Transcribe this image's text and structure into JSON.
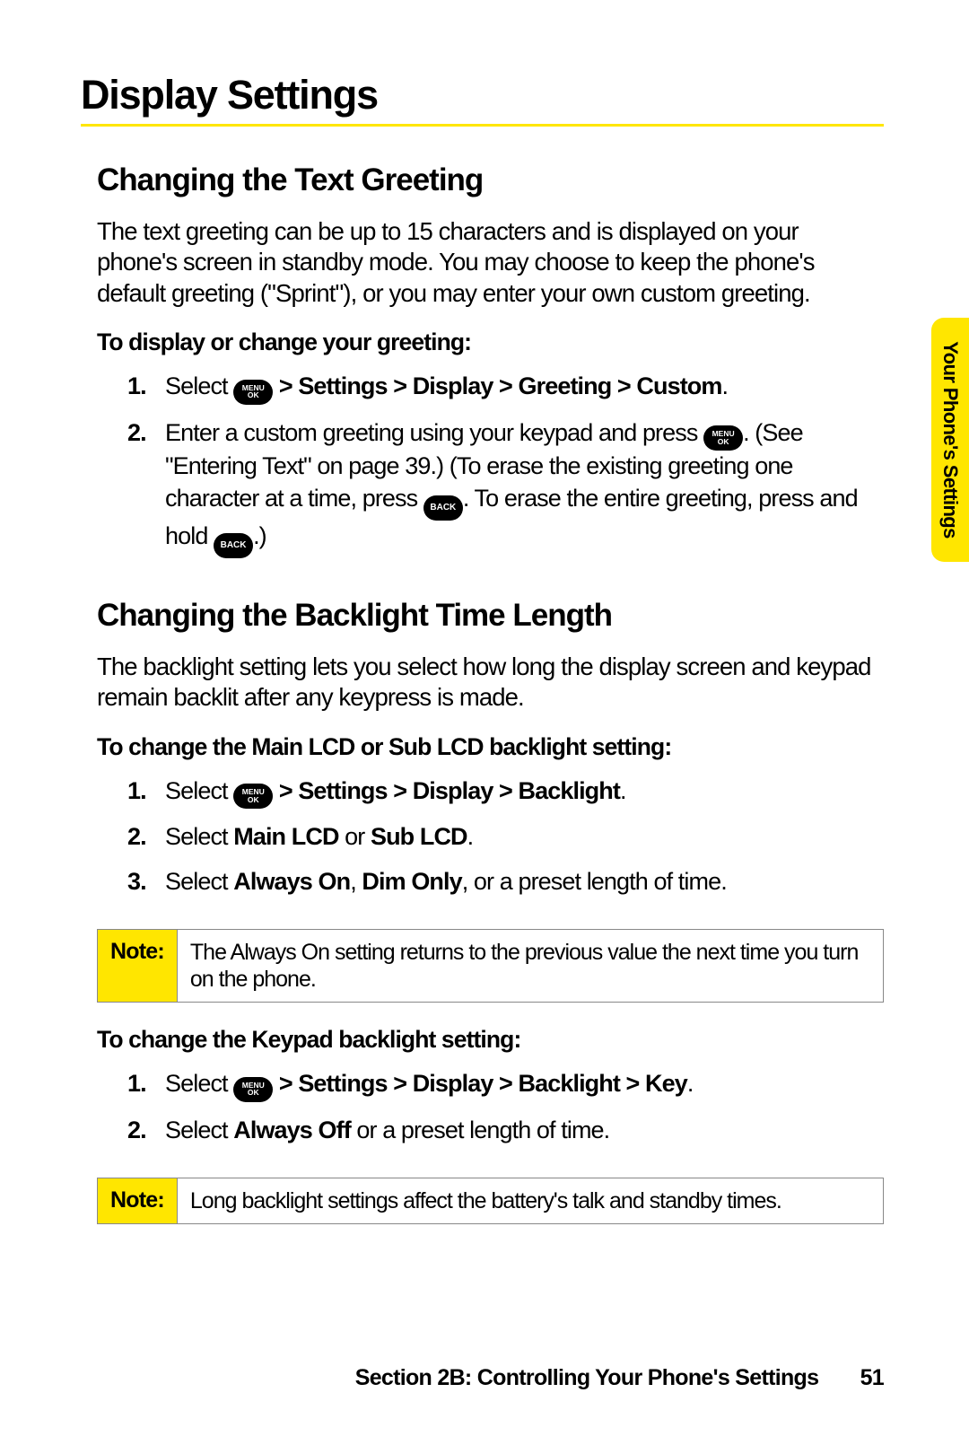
{
  "title": "Display Settings",
  "side_tab": "Your Phone's Settings",
  "section_greeting": {
    "heading": "Changing the Text Greeting",
    "intro": "The text greeting can be up to 15 characters and is displayed on your phone's screen in standby mode. You may choose to keep the phone's default greeting (\"Sprint\"), or you may enter your own custom greeting.",
    "lead": "To display or change your greeting:",
    "step1_a": "Select ",
    "step1_b": " > Settings > Display > Greeting > Custom",
    "step2_a": "Enter a custom greeting using your keypad and press ",
    "step2_b": ". (See \"Entering Text\" on page 39.) (To erase the existing greeting one character at a time, press ",
    "step2_c": ". To erase the entire greeting, press and hold ",
    "step2_d": ".)"
  },
  "section_backlight": {
    "heading": "Changing the Backlight Time Length",
    "intro": "The backlight setting lets you select how long the display screen and keypad remain backlit after any keypress is made.",
    "lead_lcd": "To change the Main LCD or Sub LCD backlight setting:",
    "lcd_step1_a": "Select ",
    "lcd_step1_b": " > Settings > Display > Backlight",
    "lcd_step2_a": "Select ",
    "lcd_step2_b": "Main LCD",
    "lcd_step2_c": " or ",
    "lcd_step2_d": "Sub LCD",
    "lcd_step3_a": "Select ",
    "lcd_step3_b": "Always On",
    "lcd_step3_c": ", ",
    "lcd_step3_d": "Dim Only",
    "lcd_step3_e": ", or a preset length of time.",
    "note1_label": "Note:",
    "note1_text": "The Always On setting returns to the previous value the next time you turn on the phone.",
    "lead_keypad": "To change the Keypad backlight setting:",
    "key_step1_a": "Select ",
    "key_step1_b": " > Settings > Display > Backlight > Key",
    "key_step2_a": "Select ",
    "key_step2_b": "Always Off",
    "key_step2_c": " or a preset length of time.",
    "note2_label": "Note:",
    "note2_text": "Long backlight settings affect the battery's talk and standby times."
  },
  "icons": {
    "menu_ok_top": "MENU",
    "menu_ok_bot": "OK",
    "back": "BACK"
  },
  "footer": {
    "text": "Section 2B: Controlling Your Phone's Settings",
    "page_number": "51"
  }
}
